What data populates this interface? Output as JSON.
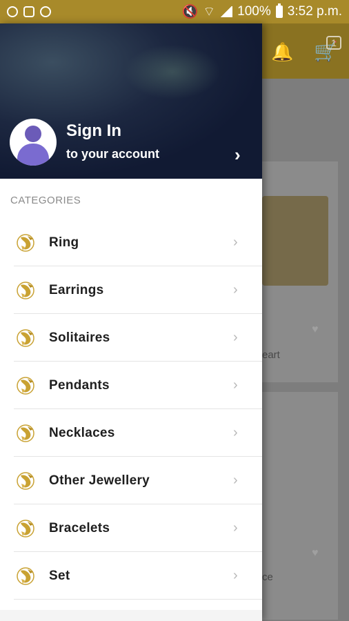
{
  "status_bar": {
    "battery": "100%",
    "time": "3:52 p.m."
  },
  "background": {
    "cart_badge": "1",
    "card1_text": "eart",
    "card2_text": "ce"
  },
  "drawer": {
    "sign_in_title": "Sign In",
    "sign_in_subtitle": "to your account",
    "chevron": "›",
    "categories_label": "CATEGORIES",
    "categories": [
      {
        "label": "Ring"
      },
      {
        "label": "Earrings"
      },
      {
        "label": "Solitaires"
      },
      {
        "label": "Pendants"
      },
      {
        "label": "Necklaces"
      },
      {
        "label": "Other Jewellery"
      },
      {
        "label": "Bracelets"
      },
      {
        "label": "Set"
      }
    ]
  },
  "colors": {
    "brand": "#a88a2a",
    "header_bg": "#1c2740",
    "icon_gold": "#c9a233"
  },
  "icons": {
    "status": [
      "instagram-icon",
      "image-icon",
      "messenger-icon",
      "mute-icon",
      "wifi-icon",
      "signal-icon",
      "battery-icon"
    ],
    "category": "gold-logo-icon",
    "chevron": "chevron-right-icon"
  }
}
